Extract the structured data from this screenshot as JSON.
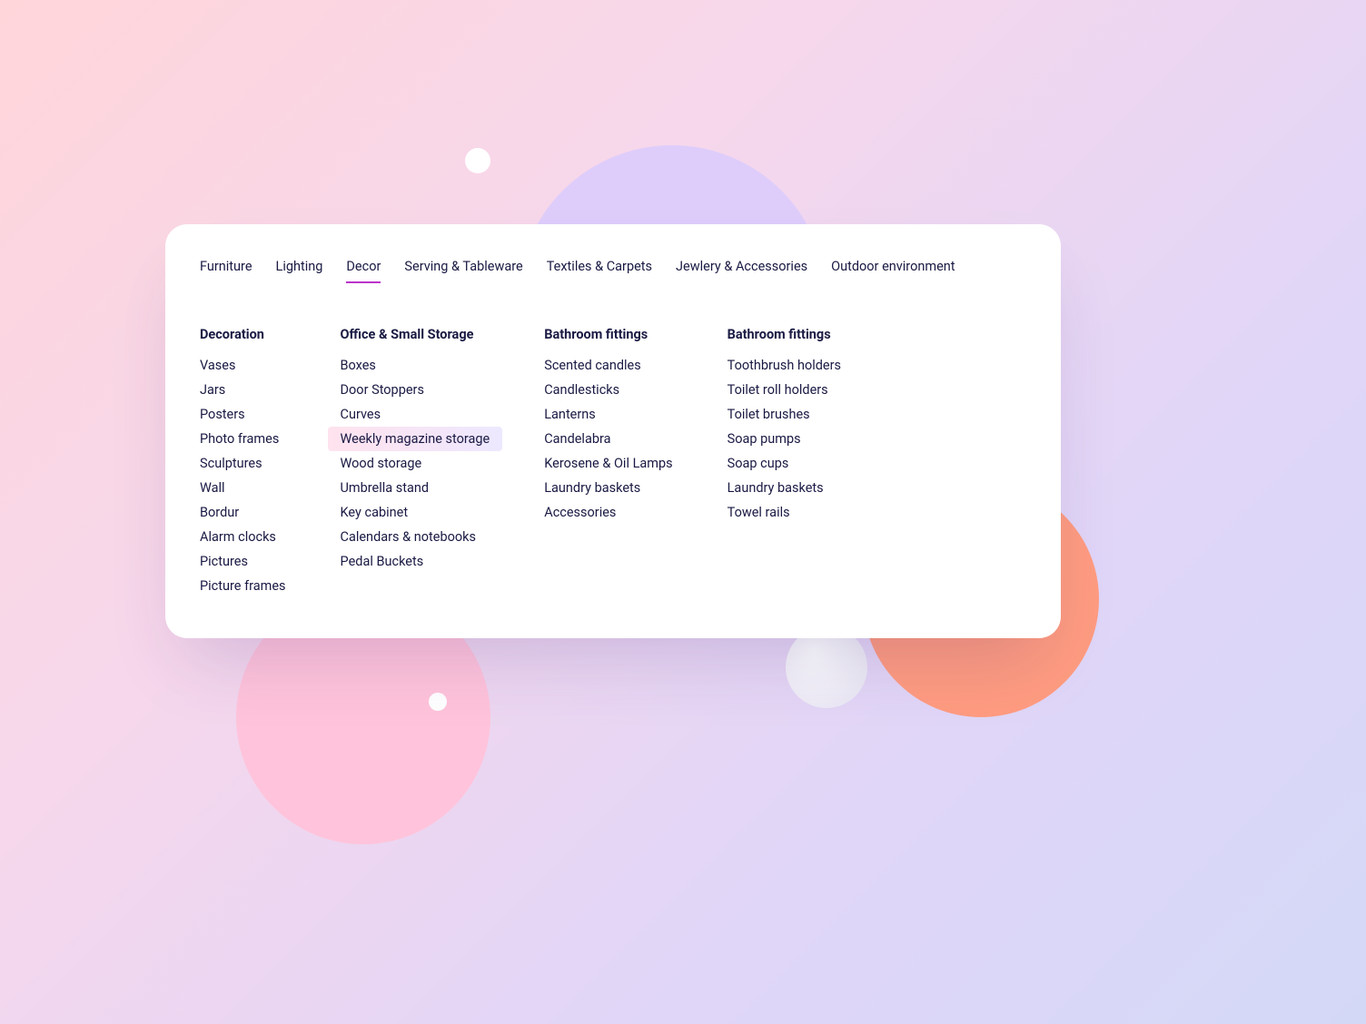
{
  "tabs": [
    {
      "label": "Furniture",
      "active": false
    },
    {
      "label": "Lighting",
      "active": false
    },
    {
      "label": "Decor",
      "active": true
    },
    {
      "label": "Serving & Tableware",
      "active": false
    },
    {
      "label": "Textiles & Carpets",
      "active": false
    },
    {
      "label": "Jewlery & Accessories",
      "active": false
    },
    {
      "label": "Outdoor environment",
      "active": false
    }
  ],
  "columns": [
    {
      "heading": "Decoration",
      "items": [
        "Vases",
        "Jars",
        "Posters",
        "Photo frames",
        "Sculptures",
        "Wall",
        "Bordur",
        "Alarm clocks",
        "Pictures",
        "Picture frames"
      ]
    },
    {
      "heading": "Office & Small Storage",
      "items": [
        "Boxes",
        "Door Stoppers",
        "Curves",
        "Weekly magazine storage",
        "Wood storage",
        "Umbrella stand",
        "Key cabinet",
        "Calendars & notebooks",
        "Pedal Buckets"
      ],
      "highlight": "Weekly magazine storage"
    },
    {
      "heading": "Bathroom fittings",
      "items": [
        "Scented candles",
        "Candlesticks",
        "Lanterns",
        "Candelabra",
        "Kerosene & Oil Lamps",
        "Laundry baskets",
        "Accessories"
      ]
    },
    {
      "heading": "Bathroom fittings",
      "items": [
        "Toothbrush holders",
        "Toilet roll holders",
        "Toilet brushes",
        "Soap pumps",
        "Soap cups",
        "Laundry baskets",
        "Towel rails"
      ]
    }
  ]
}
